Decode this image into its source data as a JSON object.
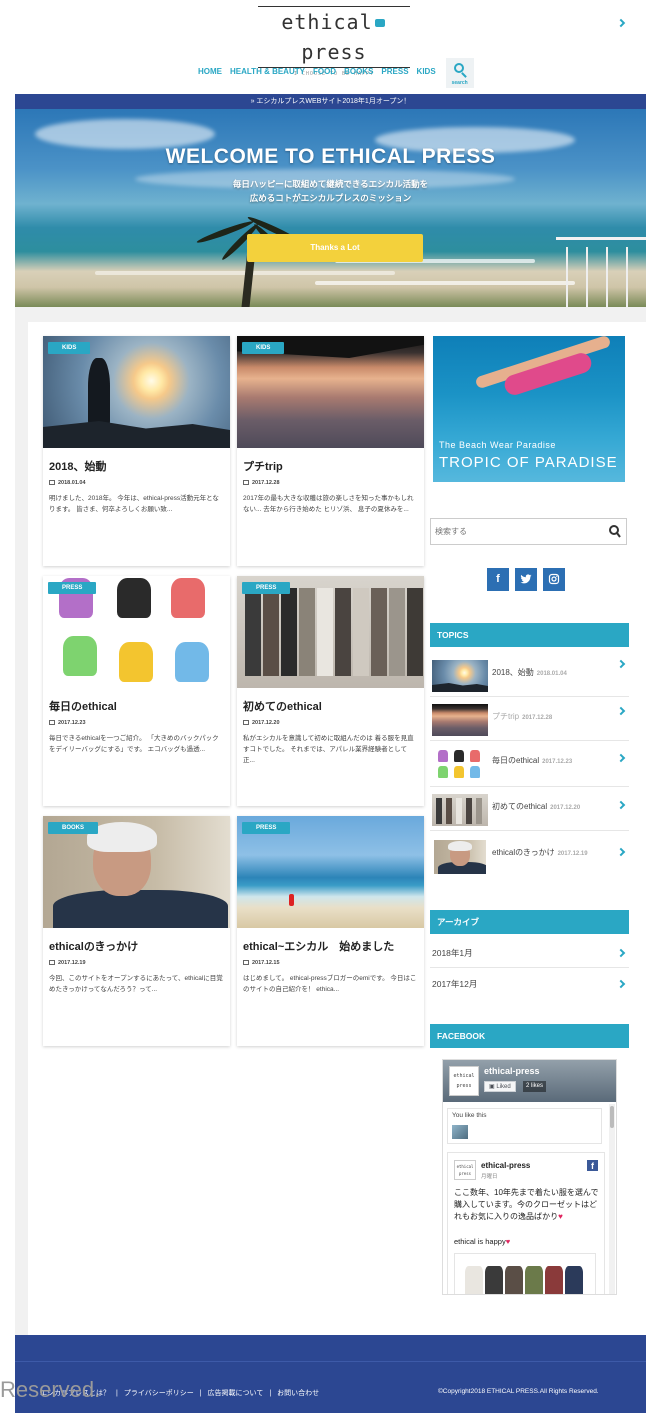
{
  "site": {
    "logo_text_1": "ethical",
    "logo_text_2": "press",
    "tagline": "I CHOOSE TO BE HAPPY"
  },
  "nav": {
    "items": [
      "HOME",
      "HEALTH & BEAUTY",
      "FOOD",
      "BOOKS",
      "PRESS",
      "KIDS"
    ],
    "search_label": "search"
  },
  "announcement": "» エシカルプレスWEBサイト2018年1月オープン！",
  "hero": {
    "title": "WELCOME TO ETHICAL PRESS",
    "subtitle_1": "毎日ハッピーに取組めて継続できるエシカル活動を",
    "subtitle_2": "広めるコトがエシカルプレスのミッション",
    "button": "Thanks a Lot"
  },
  "posts": [
    {
      "category": "KIDS",
      "title": "2018、始動",
      "date": "2018.01.04",
      "excerpt": "明けました、2018年。 今年は、ethical-press活動元年となります。 皆さま、何卒よろしくお願い致..."
    },
    {
      "category": "KIDS",
      "title": "プチtrip",
      "date": "2017.12.28",
      "excerpt": "2017年の最も大きな収穫は旅の楽しさを知った事かもしれない... 去年から行き始めた ヒリゾ浜、 息子の夏休みを..."
    },
    {
      "category": "PRESS",
      "title": "毎日のethical",
      "date": "2017.12.23",
      "excerpt": "毎日できるethicalを一つご紹介。 「大きめのバックパックをデイリーバッグにする」です。 エコバッグも過透..."
    },
    {
      "category": "PRESS",
      "title": "初めてのethical",
      "date": "2017.12.20",
      "excerpt": "私がエシカルを意識して初めに取組んだのは 着る服を見直すコトでした。 それまでは、アパレル業界経験者として 正..."
    },
    {
      "category": "BOOKS",
      "title": "ethicalのきっかけ",
      "date": "2017.12.19",
      "excerpt": "今回、このサイトをオープンするにあたって、ethicalに目覚めたきっかけってなんだろう？って..."
    },
    {
      "category": "PRESS",
      "title": "ethical~エシカル　始めました",
      "date": "2017.12.15",
      "excerpt": "はじめまして。 ethical-pressブロガーのemiです。 今日はこのサイトの自己紹介を！ ethica..."
    }
  ],
  "sidebar": {
    "banner_line_1": "The Beach Wear Paradise",
    "banner_line_2": "TROPIC OF PARADISE",
    "search_placeholder": "検索する",
    "social": [
      "f",
      "t",
      "ig"
    ],
    "topics_title": "TOPICS",
    "topics": [
      {
        "title": "2018、始動",
        "date": "2018.01.04"
      },
      {
        "title": "プチtrip",
        "date": "2017.12.28"
      },
      {
        "title": "毎日のethical",
        "date": "2017.12.23"
      },
      {
        "title": "初めてのethical",
        "date": "2017.12.20"
      },
      {
        "title": "ethicalのきっかけ",
        "date": "2017.12.19"
      }
    ],
    "archive_title": "アーカイブ",
    "archives": [
      "2018年1月",
      "2017年12月"
    ],
    "facebook_title": "FACEBOOK",
    "facebook": {
      "page_name": "ethical-press",
      "liked": "Liked",
      "likes": "2 likes",
      "you_like": "You like this",
      "post_name": "ethical-press",
      "post_day": "月曜日",
      "post_text": "ここ数年、10年先まで着たい服を選んで購入しています。今のクローゼットはどれもお気に入りの逸品ばかり",
      "post_tag": "ethical is happy",
      "logo_small": "ethical press"
    }
  },
  "footer": {
    "links": [
      "エシカルプレスとは？",
      "プライバシーポリシー",
      "広告掲載について",
      "お問い合わせ"
    ],
    "separator": "|",
    "copyright": "©Copyright2018 ETHICAL PRESS.All Rights Reserved.",
    "watermark": "Reserved."
  },
  "colors": {
    "accent": "#2aa7c4",
    "navy": "#2c4792",
    "button_yellow": "#f3d13c"
  }
}
